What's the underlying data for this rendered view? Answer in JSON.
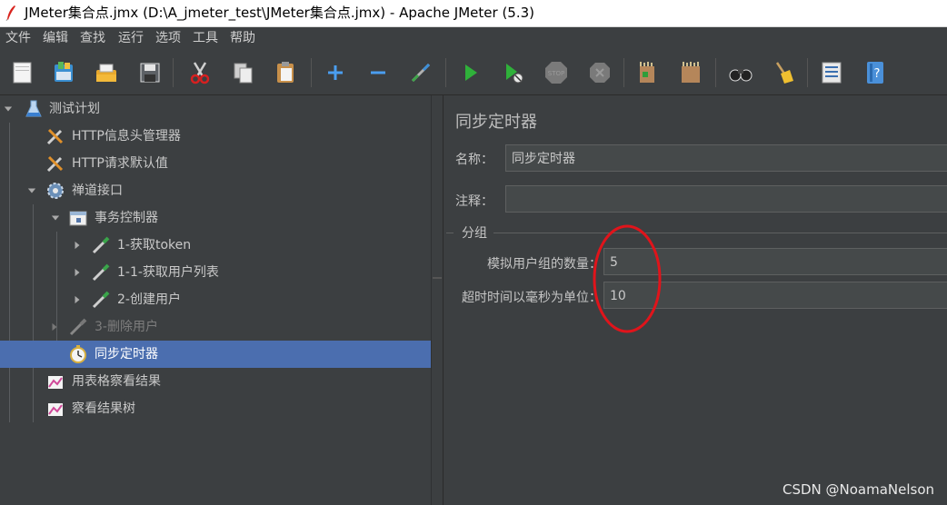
{
  "window": {
    "title": "JMeter集合点.jmx (D:\\A_jmeter_test\\JMeter集合点.jmx) - Apache JMeter (5.3)"
  },
  "menu": [
    "文件",
    "编辑",
    "查找",
    "运行",
    "选项",
    "工具",
    "帮助"
  ],
  "toolbar": {
    "buttons": [
      "new",
      "templates",
      "open",
      "save",
      "cut",
      "copy",
      "paste",
      "expand",
      "collapse",
      "toggle",
      "start",
      "start-no-pause",
      "stop",
      "shutdown",
      "clear",
      "clear-all",
      "search",
      "reset-search",
      "function-helper",
      "help"
    ]
  },
  "tree": {
    "items": [
      {
        "label": "测试计划",
        "icon": "flask-icon"
      },
      {
        "label": "HTTP信息头管理器",
        "icon": "wrench-icon"
      },
      {
        "label": "HTTP请求默认值",
        "icon": "wrench-icon"
      },
      {
        "label": "禅道接口",
        "icon": "gear-icon"
      },
      {
        "label": "事务控制器",
        "icon": "controller-icon"
      },
      {
        "label": "1-获取token",
        "icon": "pipette-icon"
      },
      {
        "label": "1-1-获取用户列表",
        "icon": "pipette-icon"
      },
      {
        "label": "2-创建用户",
        "icon": "pipette-icon"
      },
      {
        "label": "3-删除用户",
        "icon": "pipette-icon",
        "disabled": true
      },
      {
        "label": "同步定时器",
        "icon": "timer-icon",
        "selected": true
      },
      {
        "label": "用表格察看结果",
        "icon": "graph-icon"
      },
      {
        "label": "察看结果树",
        "icon": "graph-icon"
      }
    ]
  },
  "panel": {
    "title": "同步定时器",
    "name_label": "名称：",
    "name_value": "同步定时器",
    "comment_label": "注释：",
    "comment_value": "",
    "group_title": "分组",
    "users_label": "模拟用户组的数量：",
    "users_value": "5",
    "timeout_label": "超时时间以毫秒为单位：",
    "timeout_value": "10"
  },
  "annotation_color": "#e0141b",
  "selection_color": "#4b6eaf",
  "watermark": "CSDN @NoamaNelson"
}
